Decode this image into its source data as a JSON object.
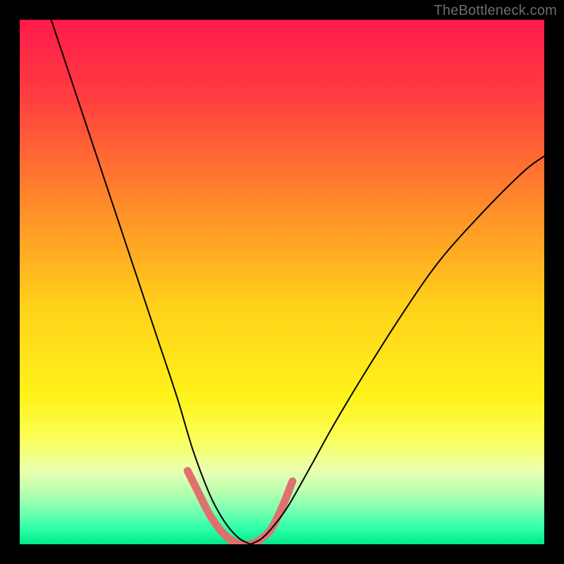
{
  "watermark": "TheBottleneck.com",
  "chart_data": {
    "type": "line",
    "title": "",
    "xlabel": "",
    "ylabel": "",
    "xlim": [
      0,
      100
    ],
    "ylim": [
      0,
      100
    ],
    "grid": false,
    "legend": false,
    "background_gradient_stops": [
      {
        "offset": 0.0,
        "color": "#ff1a4b"
      },
      {
        "offset": 0.15,
        "color": "#ff3e3f"
      },
      {
        "offset": 0.35,
        "color": "#ff8a2a"
      },
      {
        "offset": 0.55,
        "color": "#ffd21a"
      },
      {
        "offset": 0.72,
        "color": "#fff31a"
      },
      {
        "offset": 0.8,
        "color": "#fbff5a"
      },
      {
        "offset": 0.86,
        "color": "#eaffb0"
      },
      {
        "offset": 0.9,
        "color": "#b9ffb0"
      },
      {
        "offset": 0.94,
        "color": "#6fffb0"
      },
      {
        "offset": 0.97,
        "color": "#2effa8"
      },
      {
        "offset": 1.0,
        "color": "#00e88a"
      }
    ],
    "series": [
      {
        "name": "curve-left",
        "x": [
          6,
          10,
          14,
          18,
          22,
          26,
          30,
          33,
          36,
          38,
          40,
          42,
          44
        ],
        "y": [
          100,
          88,
          76,
          64,
          52,
          40,
          28,
          18,
          10,
          6,
          3,
          1,
          0
        ],
        "color": "#000000",
        "width": 2
      },
      {
        "name": "curve-right",
        "x": [
          44,
          46,
          48,
          51,
          55,
          60,
          66,
          73,
          80,
          88,
          96,
          100
        ],
        "y": [
          0,
          1,
          3,
          7,
          14,
          23,
          33,
          44,
          54,
          63,
          71,
          74
        ],
        "color": "#000000",
        "width": 2
      },
      {
        "name": "bottom-highlight",
        "x": [
          32,
          34,
          36,
          38,
          40,
          42,
          44,
          46,
          48,
          50,
          52
        ],
        "y": [
          14,
          10,
          6,
          3,
          1,
          0,
          0,
          1,
          3,
          7,
          12
        ],
        "color": "#e07070",
        "width": 11
      }
    ],
    "annotations": []
  }
}
